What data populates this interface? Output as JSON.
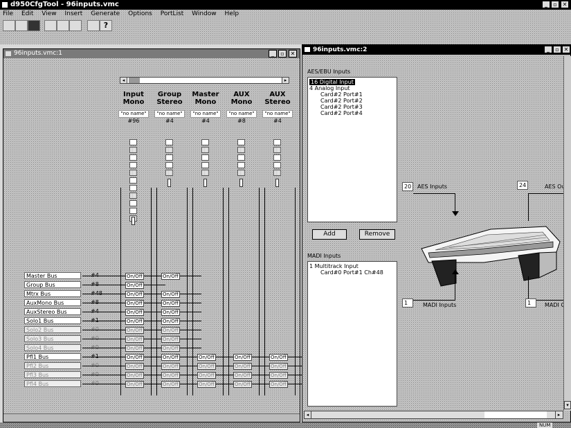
{
  "app": {
    "title": "d950CfgTool - 96inputs.vmc",
    "menu": [
      "File",
      "Edit",
      "View",
      "Insert",
      "Generate",
      "Options",
      "PortList",
      "Window",
      "Help"
    ]
  },
  "left_window": {
    "title": "96inputs.vmc:1",
    "columns": [
      {
        "line1": "Input",
        "line2": "Mono",
        "name": "\"no name\"",
        "num": "#96"
      },
      {
        "line1": "Group",
        "line2": "Stereo",
        "name": "\"no name\"",
        "num": "#4"
      },
      {
        "line1": "Master",
        "line2": "Mono",
        "name": "\"no name\"",
        "num": "#4"
      },
      {
        "line1": "AUX",
        "line2": "Mono",
        "name": "\"no name\"",
        "num": "#8"
      },
      {
        "line1": "AUX",
        "line2": "Stereo",
        "name": "\"no name\"",
        "num": "#4"
      }
    ],
    "onoff_label": "On/Off",
    "bus_rows": [
      {
        "label": "Master Bus",
        "num": "#4"
      },
      {
        "label": "Group Bus",
        "num": "#8"
      },
      {
        "label": "Mtrx Bus",
        "num": "#48"
      },
      {
        "label": "AuxMono Bus",
        "num": "#8"
      },
      {
        "label": "AuxStereo Bus",
        "num": "#4"
      },
      {
        "label": "Solo1 Bus",
        "num": "#1"
      },
      {
        "label": "Solo2 Bus",
        "num": "#0"
      },
      {
        "label": "Solo3 Bus",
        "num": "#0"
      },
      {
        "label": "Solo4 Bus",
        "num": "#0"
      },
      {
        "label": "Pfl1 Bus",
        "num": "#1"
      },
      {
        "label": "Pfl2 Bus",
        "num": "#0"
      },
      {
        "label": "Pfl3 Bus",
        "num": "#0"
      },
      {
        "label": "Pfl4 Bus",
        "num": "#0"
      }
    ]
  },
  "right_window": {
    "title": "96inputs.vmc:2",
    "aes_label": "AES/EBU Inputs",
    "aes_items": [
      {
        "text": "16 Digital Input",
        "selected": true
      },
      {
        "text": "4 Analog Input",
        "selected": false
      },
      {
        "text": "Card#2 Port#1",
        "selected": false
      },
      {
        "text": "Card#2 Port#2",
        "selected": false
      },
      {
        "text": "Card#2 Port#3",
        "selected": false
      },
      {
        "text": "Card#2 Port#4",
        "selected": false
      }
    ],
    "add_button": "Add",
    "remove_button": "Remove",
    "madi_label": "MADI Inputs",
    "madi_items": [
      "1 Multitrack Input",
      "Card#0 Port#1 Ch#48"
    ],
    "aes_in_count": "20",
    "aes_in_label": "AES Inputs",
    "aes_out_count": "24",
    "aes_out_label": "AES Ou",
    "madi_in_count": "1",
    "madi_in_label": "MADI Inputs",
    "madi_out_count": "1",
    "madi_out_label": "MADI O"
  },
  "status": {
    "num": "NUM"
  }
}
